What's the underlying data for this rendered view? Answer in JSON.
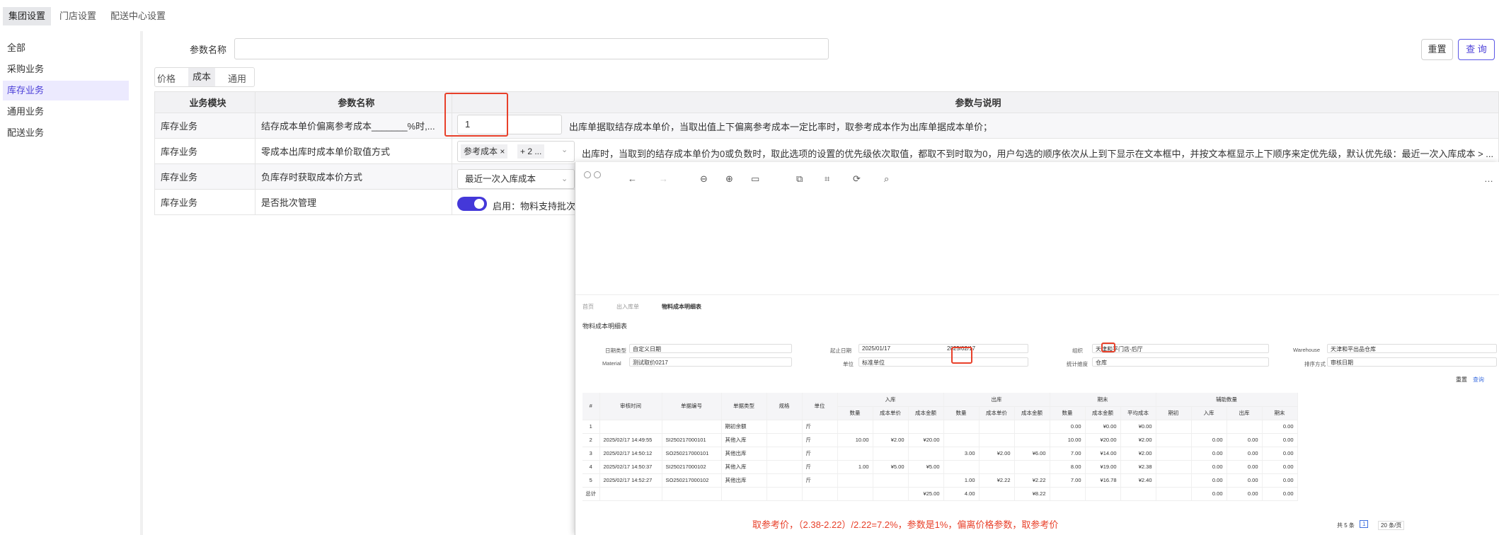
{
  "top_tabs": [
    "集团设置",
    "门店设置",
    "配送中心设置"
  ],
  "sidebar": [
    "全部",
    "采购业务",
    "库存业务",
    "通用业务",
    "配送业务"
  ],
  "search": {
    "label": "参数名称",
    "value": ""
  },
  "buttons": {
    "reset": "重置",
    "query": "查 询"
  },
  "sub_tabs": [
    "价格",
    "成本",
    "通用"
  ],
  "table": {
    "headers": [
      "业务模块",
      "参数名称",
      "参数与说明"
    ],
    "rows": [
      {
        "module": "库存业务",
        "name": "结存成本单价偏离参考成本_______%时,...",
        "value": "1",
        "desc": "出库单据取结存成本单价，当取出值上下偏离参考成本一定比率时，取参考成本作为出库单据成本单价；"
      },
      {
        "module": "库存业务",
        "name": "零成本出库时成本单价取值方式",
        "tag": "参考成本",
        "more": "+ 2 ...",
        "desc": "出库时，当取到的结存成本单价为0或负数时，取此选项的设置的优先级依次取值，都取不到时取为0，用户勾选的顺序依次从上到下显示在文本框中，并按文本框显示上下顺序来定优先级，默认优先级：最近一次入库成本 > ..."
      },
      {
        "module": "库存业务",
        "name": "负库存时获取成本价方式",
        "select": "最近一次入库成本"
      },
      {
        "module": "库存业务",
        "name": "是否批次管理",
        "switch": "启用：物料支持批次"
      }
    ]
  },
  "screenshot": {
    "breadcrumb_tabs": [
      "首页",
      "出入库单",
      "物料成本明细表"
    ],
    "title": "物料成本明细表",
    "filters": {
      "date_type_label": "日期类型",
      "date_type": "自定义日期",
      "range_label": "起止日期",
      "date_from": "2025/01/17",
      "date_to": "2025/02/17",
      "org_label": "组织",
      "org": "天津和平门店-后厅",
      "warehouse_label": "Warehouse",
      "warehouse": "天津和平出品仓库",
      "material_label": "Material",
      "material": "测试取价0217",
      "unit_label": "单位",
      "unit": "标准单位",
      "dim_label": "统计维度",
      "dim": "仓库",
      "sort_label": "排序方式",
      "sort": "审核日期"
    },
    "col_headers": [
      "#",
      "审核时间",
      "单据编号",
      "单据类型",
      "规格",
      "单位",
      "入库",
      "出库",
      "期末",
      "辅助数量"
    ],
    "sub_headers": [
      "数量",
      "成本单价",
      "成本金额",
      "数量",
      "成本单价",
      "成本金额",
      "数量",
      "成本金额",
      "平均成本",
      "期初",
      "入库",
      "出库",
      "期末"
    ],
    "rows": [
      [
        "1",
        "",
        "",
        "期初余额",
        "",
        "斤",
        "",
        "",
        "",
        "",
        "",
        "",
        "0.00",
        "¥0.00",
        "¥0.00",
        "",
        "",
        "",
        "0.00"
      ],
      [
        "2",
        "2025/02/17 14:49:55",
        "SI250217000101",
        "其他入库",
        "",
        "斤",
        "10.00",
        "¥2.00",
        "¥20.00",
        "",
        "",
        "",
        "10.00",
        "¥20.00",
        "¥2.00",
        "",
        "0.00",
        "0.00",
        "0.00"
      ],
      [
        "3",
        "2025/02/17 14:50:12",
        "SO250217000101",
        "其他出库",
        "",
        "斤",
        "",
        "",
        "",
        "3.00",
        "¥2.00",
        "¥6.00",
        "7.00",
        "¥14.00",
        "¥2.00",
        "",
        "0.00",
        "0.00",
        "0.00"
      ],
      [
        "4",
        "2025/02/17 14:50:37",
        "SI250217000102",
        "其他入库",
        "",
        "斤",
        "1.00",
        "¥5.00",
        "¥5.00",
        "",
        "",
        "",
        "8.00",
        "¥19.00",
        "¥2.38",
        "",
        "0.00",
        "0.00",
        "0.00"
      ],
      [
        "5",
        "2025/02/17 14:52:27",
        "SO250217000102",
        "其他出库",
        "",
        "斤",
        "",
        "",
        "",
        "1.00",
        "¥2.22",
        "¥2.22",
        "7.00",
        "¥16.78",
        "¥2.40",
        "",
        "0.00",
        "0.00",
        "0.00"
      ],
      [
        "总计",
        "",
        "",
        "",
        "",
        "",
        "",
        "",
        "¥25.00",
        "4.00",
        "",
        "¥8.22",
        "",
        "",
        "",
        "",
        "0.00",
        "0.00",
        "0.00"
      ]
    ],
    "footer_total": "共 5 条",
    "footer_page": "1",
    "footer_size": "20 条/页",
    "buttons_right": [
      "重置",
      "查询"
    ],
    "annotation": "取参考价，（2.38-2.22）/2.22=7.2%，参数是1%，偏离价格参数，取参考价"
  }
}
